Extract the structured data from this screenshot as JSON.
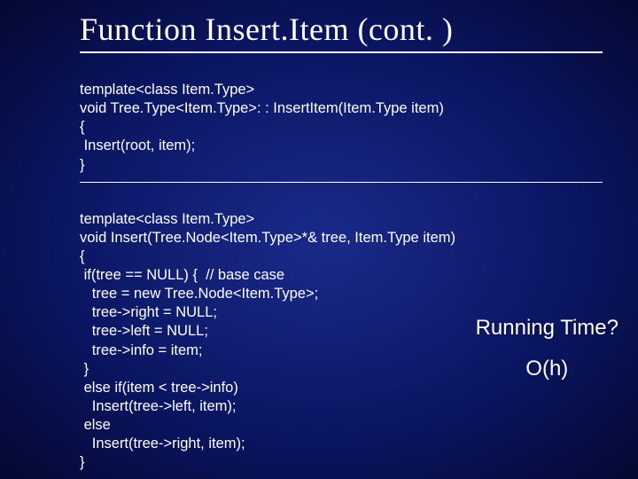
{
  "title": "Function Insert.Item (cont. )",
  "block1": {
    "l1": "template<class Item.Type>",
    "l2": "void Tree.Type<Item.Type>: : InsertItem(Item.Type item)",
    "l3": "{",
    "l4": " Insert(root, item);",
    "l5": "}"
  },
  "block2": {
    "l1": "template<class Item.Type>",
    "l2": "void Insert(Tree.Node<Item.Type>*& tree, Item.Type item)",
    "l3": "{",
    "l4": " if(tree == NULL) {  // base case",
    "l5": "   tree = new Tree.Node<Item.Type>;",
    "l6": "   tree->right = NULL;",
    "l7": "   tree->left = NULL;",
    "l8": "   tree->info = item;",
    "l9": " }",
    "l10": " else if(item < tree->info)",
    "l11": "   Insert(tree->left, item);",
    "l12": " else",
    "l13": "   Insert(tree->right, item);",
    "l14": "}"
  },
  "side": {
    "question": "Running Time?",
    "answer": "O(h)"
  },
  "chart_data": {
    "type": "table",
    "title": "Function Insert.Item (cont.)",
    "functions": [
      {
        "name": "Tree.Type<Item.Type>::InsertItem",
        "template": "template<class Item.Type>",
        "signature": "void Tree.Type<Item.Type>::InsertItem(Item.Type item)",
        "body": "Insert(root, item);"
      },
      {
        "name": "Insert",
        "template": "template<class Item.Type>",
        "signature": "void Insert(Tree.Node<Item.Type>*& tree, Item.Type item)",
        "body_lines": [
          "if(tree == NULL) { // base case",
          "  tree = new Tree.Node<Item.Type>;",
          "  tree->right = NULL;",
          "  tree->left = NULL;",
          "  tree->info = item;",
          "}",
          "else if(item < tree->info)",
          "  Insert(tree->left, item);",
          "else",
          "  Insert(tree->right, item);"
        ]
      }
    ],
    "running_time": "O(h)"
  }
}
